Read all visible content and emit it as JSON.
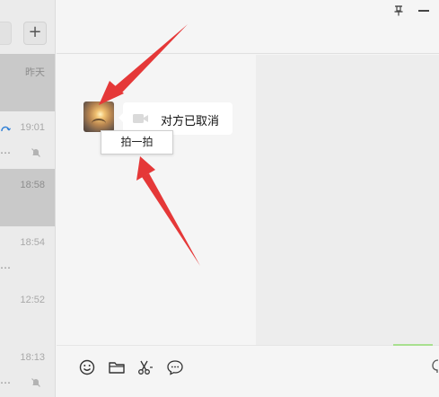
{
  "sidebar": {
    "add_label": "+",
    "conversations": [
      {
        "time": "昨天",
        "selected": true,
        "muted": false
      },
      {
        "time": "19:01",
        "selected": false,
        "muted": true
      },
      {
        "time": "18:58",
        "selected": true,
        "muted": false
      },
      {
        "time": "18:54",
        "selected": false,
        "muted": false
      },
      {
        "time": "12:52",
        "selected": false,
        "muted": false
      },
      {
        "time": "18:13",
        "selected": false,
        "muted": true
      }
    ]
  },
  "chat": {
    "call_message": "对方已取消",
    "context_menu": {
      "pat_label": "拍一拍"
    }
  },
  "toolbar": {
    "icons": [
      "emoji-icon",
      "folder-icon",
      "scissors-icon",
      "chat-bubble-icon"
    ]
  },
  "colors": {
    "arrow": "#e53838",
    "bubble": "#ffffff",
    "selected_row": "#c9c9c9",
    "accent_green": "#a8e08f"
  }
}
